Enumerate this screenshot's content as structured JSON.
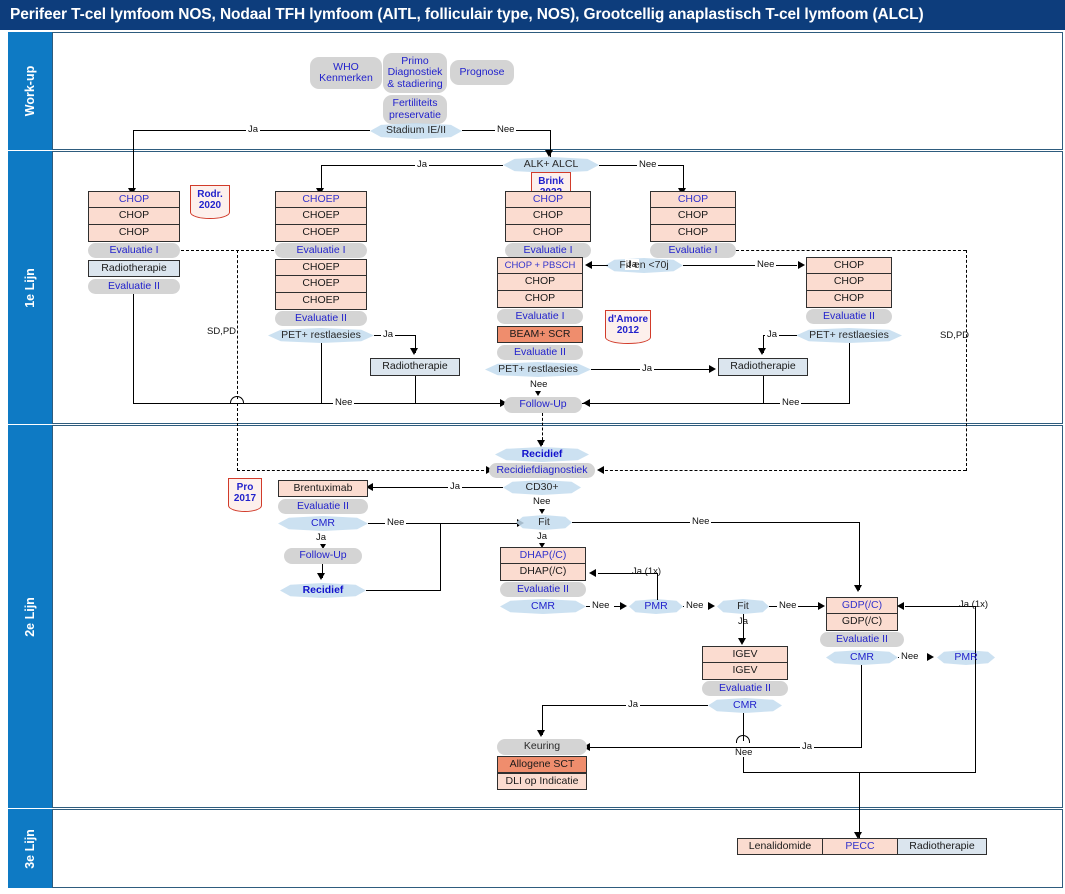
{
  "header": {
    "title": "Perifeer T-cel lymfoom NOS, Nodaal TFH lymfoom (AITL, folliculair type, NOS), Grootcellig anaplastisch T-cel lymfoom (ALCL)"
  },
  "lanes": [
    {
      "id": "workup",
      "label": "Work-up"
    },
    {
      "id": "lijn1",
      "label": "1e Lijn"
    },
    {
      "id": "lijn2",
      "label": "2e Lijn"
    },
    {
      "id": "lijn3",
      "label": "3e Lijn"
    }
  ],
  "colors": {
    "header_bg": "#0d3d7c",
    "lane_bg": "#0e7ac4",
    "chemo_box": "#fbdcd0",
    "transplant_box": "#ef8d6d",
    "radio_box": "#dbe5ee",
    "process_box": "#d4d4d4",
    "decision_lens": "#c3dcef",
    "reference_border": "#d13b2a",
    "text_blue": "#2222cc"
  },
  "workup": {
    "who": "WHO\nKenmerken",
    "who_l1": "WHO",
    "who_l2": "Kenmerken",
    "primo_l1": "Primo",
    "primo_l2": "Diagnostiek",
    "primo_l3": "& stadiering",
    "prognose": "Prognose",
    "fert_l1": "Fertiliteits",
    "fert_l2": "preservatie",
    "stadium": "Stadium IE/II",
    "ja": "Ja",
    "nee": "Nee"
  },
  "lijn1": {
    "alk": "ALK+ ALCL",
    "ja": "Ja",
    "nee": "Nee",
    "sd_pd": "SD,PD",
    "chop": "CHOP",
    "choep": "CHOEP",
    "chop_pbsch": "CHOP + PBSCH",
    "beam": "BEAM+ SCR",
    "eval1": "Evaluatie I",
    "eval2": "Evaluatie II",
    "radio": "Radiotherapie",
    "petrest": "PET+ restlaesies",
    "fit70": "Fit en <70j",
    "followup": "Follow-Up",
    "refs": [
      {
        "name": "Rodr.",
        "year": "2020"
      },
      {
        "name": "Brink",
        "year": "2022"
      },
      {
        "name": "d'Amore",
        "year": "2012"
      }
    ]
  },
  "lijn2": {
    "recidief": "Recidief",
    "recidiefdiag": "Recidiefdiagnostiek",
    "cd30": "CD30+",
    "brentuximab": "Brentuximab",
    "eval2": "Evaluatie II",
    "cmr": "CMR",
    "pmr": "PMR",
    "fit": "Fit",
    "followup": "Follow-Up",
    "dhap": "DHAP(/C)",
    "gdp": "GDP(/C)",
    "igev": "IGEV",
    "keuring": "Keuring",
    "allo_sct": "Allogene SCT",
    "dli": "DLI op Indicatie",
    "ja": "Ja",
    "nee": "Nee",
    "ja1x": "Ja (1x)",
    "ref": {
      "name": "Pro",
      "year": "2017"
    }
  },
  "lijn3": {
    "lenalidomide": "Lenalidomide",
    "pecc": "PECC",
    "radio": "Radiotherapie"
  }
}
